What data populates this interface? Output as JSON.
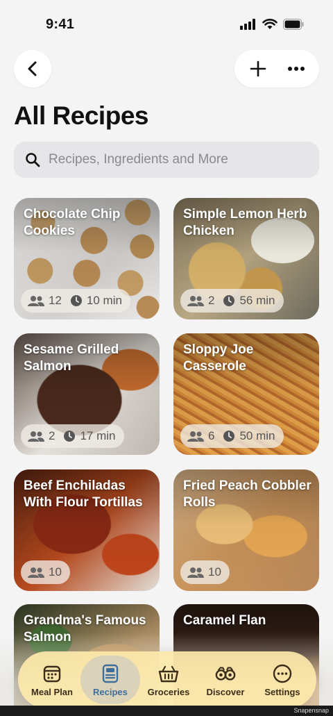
{
  "status_bar": {
    "time": "9:41"
  },
  "header": {
    "title": "All Recipes"
  },
  "search": {
    "placeholder": "Recipes, Ingredients and More"
  },
  "recipes": [
    {
      "title": "Chocolate Chip Cookies",
      "servings": "12",
      "time": "10 min"
    },
    {
      "title": "Simple Lemon Herb Chicken",
      "servings": "2",
      "time": "56 min"
    },
    {
      "title": "Sesame Grilled Salmon",
      "servings": "2",
      "time": "17 min"
    },
    {
      "title": "Sloppy Joe Casserole",
      "servings": "6",
      "time": "50 min"
    },
    {
      "title": "Beef Enchiladas With Flour Tortillas",
      "servings": "10"
    },
    {
      "title": "Fried Peach Cobbler Rolls",
      "servings": "10"
    },
    {
      "title": "Grandma's Famous Salmon"
    },
    {
      "title": "Caramel Flan"
    }
  ],
  "tabs": [
    {
      "label": "Meal Plan",
      "icon": "meal-plan-icon"
    },
    {
      "label": "Recipes",
      "icon": "recipes-icon",
      "active": true
    },
    {
      "label": "Groceries",
      "icon": "basket-icon"
    },
    {
      "label": "Discover",
      "icon": "binoculars-icon"
    },
    {
      "label": "Settings",
      "icon": "more-icon"
    }
  ],
  "watermark": "Snapensnap",
  "colors": {
    "tab_bar": "#fce8aa",
    "active_tab_text": "#3e6e9e"
  }
}
